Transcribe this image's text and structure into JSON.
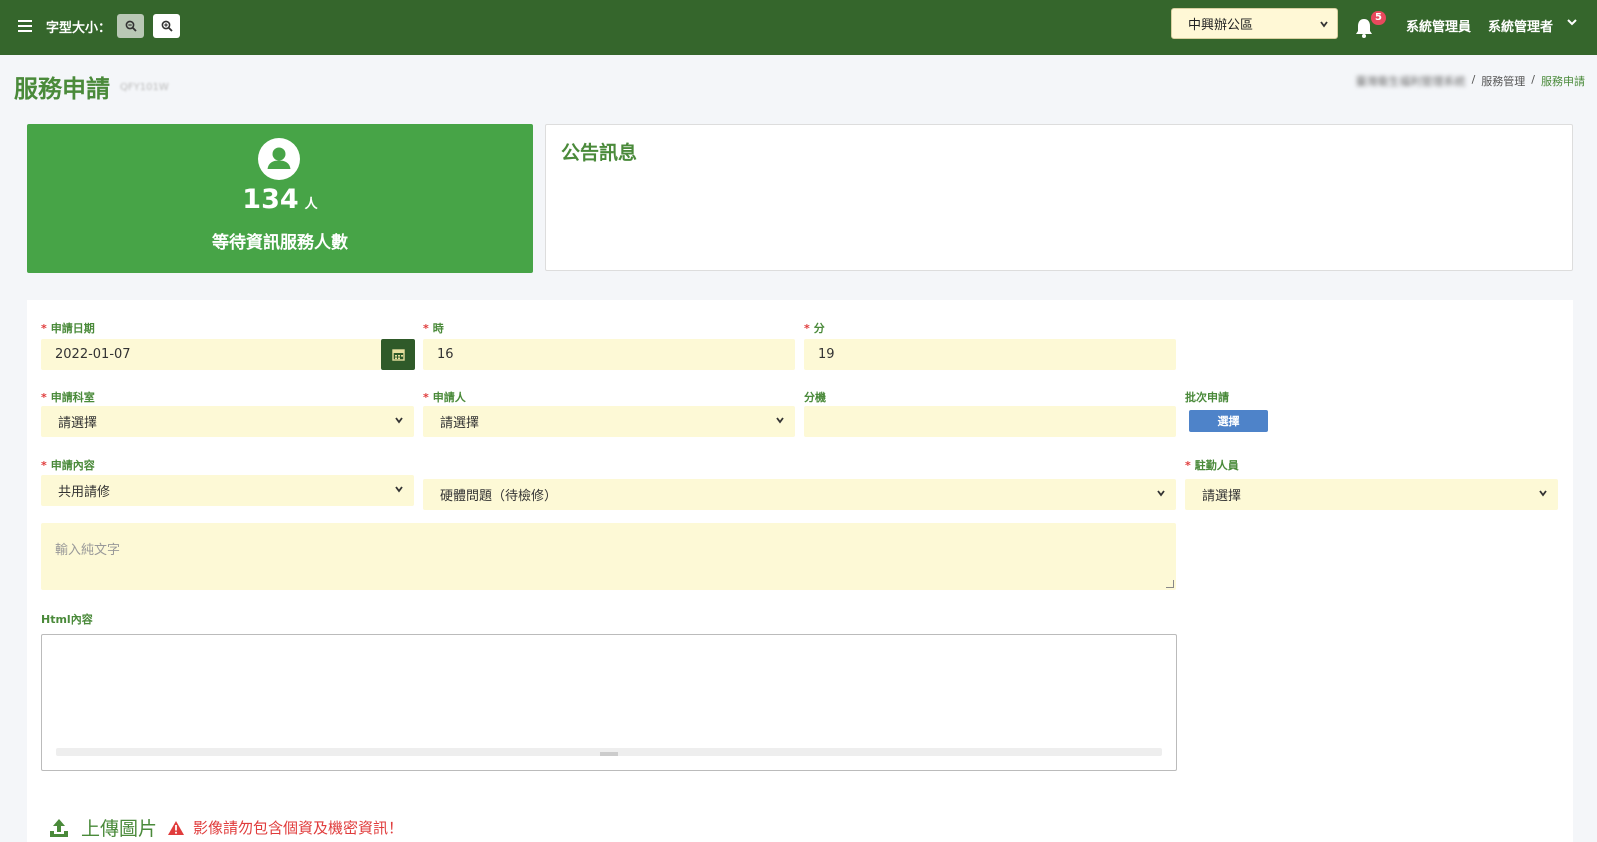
{
  "header": {
    "font_size_label": "字型大小：",
    "district": "中興辦公區",
    "notification_count": "5",
    "user_role": "系統管理員",
    "user_name": "系統管理者"
  },
  "page": {
    "title": "服務申請",
    "code": "QFY101W",
    "breadcrumb": {
      "root": "臺灣衛生福利管理系統",
      "sep": "/",
      "parent": "服務管理",
      "current": "服務申請"
    }
  },
  "stats": {
    "count": "134",
    "unit": "人",
    "label": "等待資訊服務人數"
  },
  "announcement": {
    "title": "公告訊息"
  },
  "form": {
    "date_label": "申請日期",
    "date_value": "2022-01-07",
    "hour_label": "時",
    "hour_value": "16",
    "minute_label": "分",
    "minute_value": "19",
    "dept_label": "申請科室",
    "dept_value": "請選擇",
    "applicant_label": "申請人",
    "applicant_value": "請選擇",
    "ext_label": "分機",
    "ext_value": "",
    "batch_label": "批次申請",
    "batch_button": "選擇",
    "content_label": "申請內容",
    "content_type": "共用請修",
    "content_subtype": "硬體問題（待檢修）",
    "staff_label": "駐勤人員",
    "staff_value": "請選擇",
    "text_placeholder": "輸入純文字",
    "html_label": "Html內容"
  },
  "upload": {
    "label": "上傳圖片",
    "warning": "影像請勿包含個資及機密資訊！"
  },
  "colors": {
    "topbar": "#35662c",
    "accent": "#4a8a3a",
    "stat_card": "#47a447",
    "field_bg": "#fdf9d6",
    "required": "#e03c3c",
    "batch_button": "#4e83c9"
  }
}
